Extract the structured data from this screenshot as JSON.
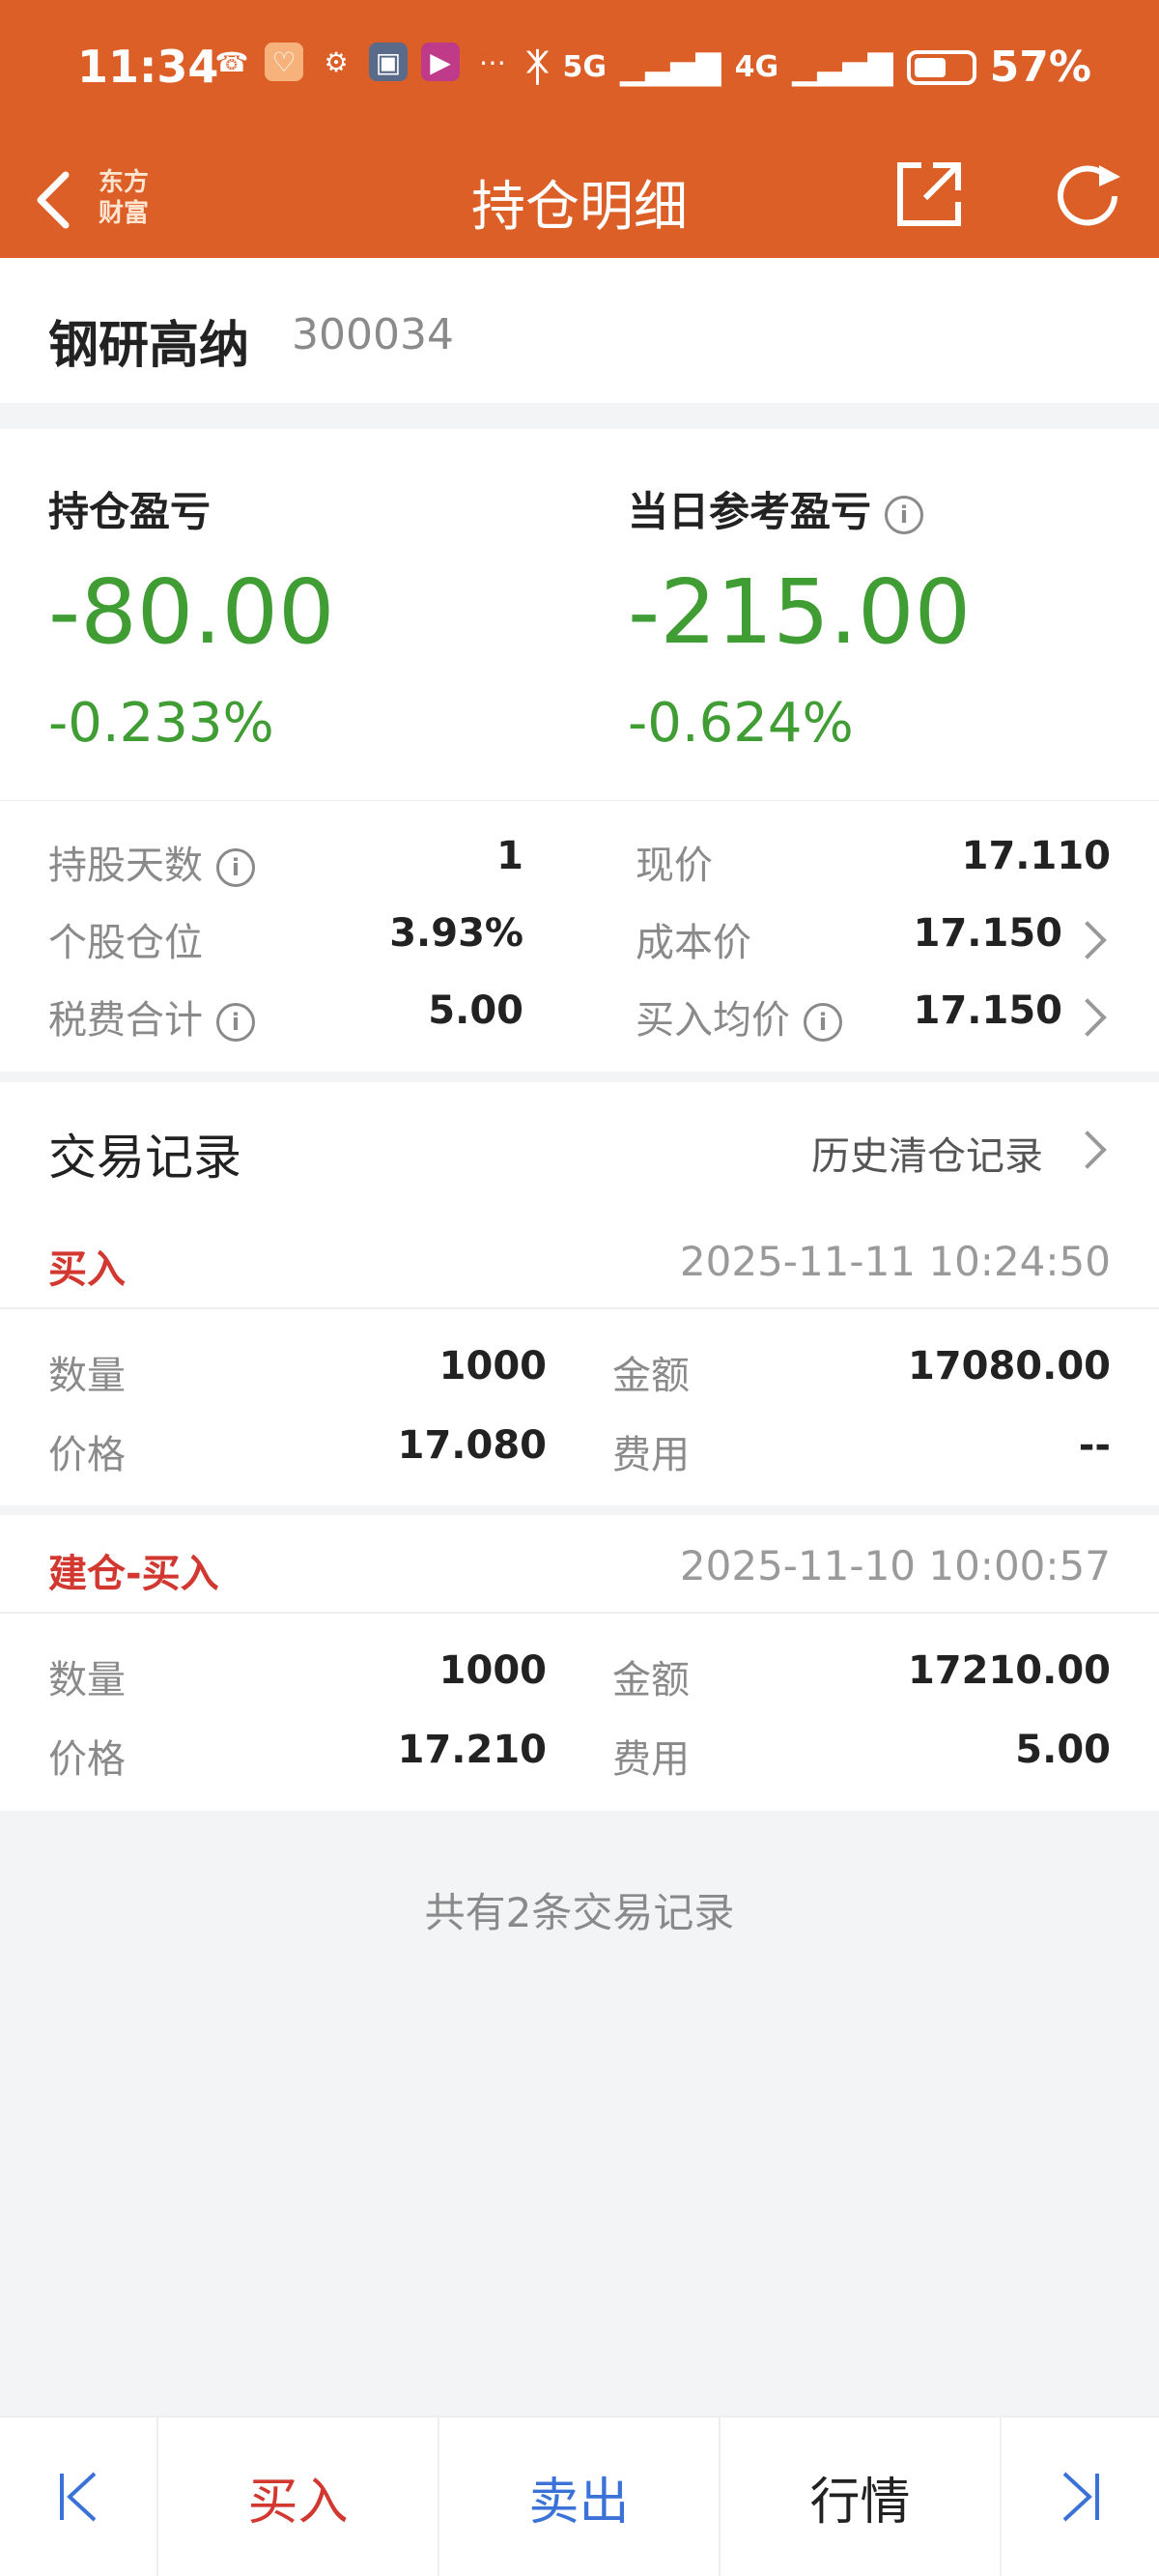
{
  "status_bar": {
    "time": "11:34",
    "network1": "5G",
    "network2": "4G",
    "battery": "57%",
    "battery_level": 0.57
  },
  "nav": {
    "logo_line1": "东方",
    "logo_line2": "财富",
    "title": "持仓明细"
  },
  "stock": {
    "name": "钢研高纳",
    "code": "300034"
  },
  "pnl": {
    "hold_label": "持仓盈亏",
    "hold_value": "-80.00",
    "hold_pct": "-0.233%",
    "day_label": "当日参考盈亏",
    "day_value": "-215.00",
    "day_pct": "-0.624%"
  },
  "details": {
    "days_label": "持股天数",
    "days_value": "1",
    "position_label": "个股仓位",
    "position_value": "3.93%",
    "fees_label": "税费合计",
    "fees_value": "5.00",
    "price_label": "现价",
    "price_value": "17.110",
    "cost_label": "成本价",
    "cost_value": "17.150",
    "avg_label": "买入均价",
    "avg_value": "17.150"
  },
  "records": {
    "title": "交易记录",
    "history_link": "历史清仓记录",
    "items": [
      {
        "type": "买入",
        "time": "2025-11-11 10:24:50",
        "qty_label": "数量",
        "qty": "1000",
        "amount_label": "金额",
        "amount": "17080.00",
        "price_label": "价格",
        "price": "17.080",
        "fee_label": "费用",
        "fee": "--"
      },
      {
        "type": "建仓-买入",
        "time": "2025-11-10 10:00:57",
        "qty_label": "数量",
        "qty": "1000",
        "amount_label": "金额",
        "amount": "17210.00",
        "price_label": "价格",
        "price": "17.210",
        "fee_label": "费用",
        "fee": "5.00"
      }
    ],
    "summary": "共有2条交易记录"
  },
  "bottom_bar": {
    "buy": "买入",
    "sell": "卖出",
    "quote": "行情"
  },
  "colors": {
    "brand": "#dc5f28",
    "loss": "#3f9d34",
    "buy": "#d2382f",
    "sell": "#3a72d8"
  }
}
